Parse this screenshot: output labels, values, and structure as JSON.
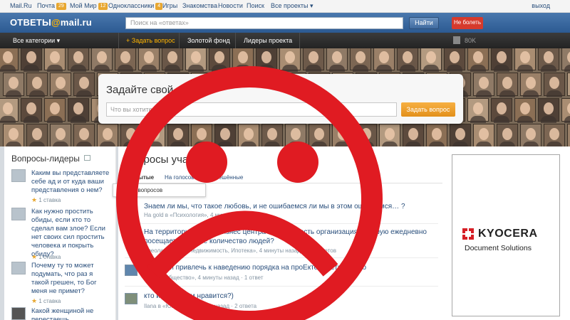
{
  "portal_bar": {
    "links": [
      {
        "label": "Mail.Ru"
      },
      {
        "label": "Почта",
        "count": "29"
      },
      {
        "label": "Мой Мир",
        "count": "12"
      },
      {
        "label": "Одноклассники",
        "count": "4"
      },
      {
        "label": "Игры"
      },
      {
        "label": "Знакомства"
      },
      {
        "label": "Новости"
      },
      {
        "label": "Поиск"
      },
      {
        "label": "Все проекты ▾"
      }
    ],
    "exit_label": "выход"
  },
  "header": {
    "logo_left": "ОТВЕТЫ",
    "logo_at": "@",
    "logo_right": "mail.ru",
    "search_placeholder": "Поиск на «ответах»",
    "find_button": "Найти",
    "no_ill_button": "Не болеть"
  },
  "nav": {
    "categories": "Все категории ▾",
    "ask": "+ Задать вопрос",
    "golden": "Золотой фонд",
    "leaders": "Лидеры проекта",
    "online_count": "80K"
  },
  "ask_panel": {
    "title": "Задайте свой вопрос",
    "input_placeholder": "Что вы хотите узнать",
    "submit": "Задать вопрос"
  },
  "left": {
    "title": "Вопросы-лидеры",
    "questions": [
      {
        "text": "Каким вы представляете себе ад и от куда ваши представления о нем?",
        "meta": "1 ставка"
      },
      {
        "text": "Как нужно простить обиды, если кто то сделал вам злое? Если нет своих сил простить человека и покрыть обиду?",
        "meta": "1 ставка"
      },
      {
        "text": "Почему ту то может подумать, что раз я такой грешен, то Бог меня не примет?",
        "meta": "1 ставка"
      },
      {
        "text": "Какой женщиной не перестаешь",
        "meta": ""
      }
    ]
  },
  "main": {
    "title": "Вопросы участн",
    "tabs": [
      "Открытые",
      "На голосовании",
      "Решённые"
    ],
    "dropdown_item": "Новых вопросов",
    "questions": [
      {
        "text": "Знаем ли мы, что такое любовь, и не ошибаемся ли мы в этом ошибаемся… ?",
        "meta": "На gold в «Психология», 4 минуты назад"
      },
      {
        "text": "На территории какого бизнес центра в Москве есть организация, которую ежедневно посещает большое количество людей?",
        "meta": "Ареола г. М... в «Недвижимость, Ипотека», 4 минуты назад · нет ответов"
      },
      {
        "text": "Путина и привлечь к наведению порядка на проЕкте ответы можно",
        "meta": "му... в «Общество», 4 минуты назад · 1 ответ"
      },
      {
        "text": "кто из «…» вам нравится?)",
        "meta": "Ilana в «Юмор», 4 минуты назад · 2 ответа"
      }
    ]
  },
  "ad": {
    "brand": "KYOCERA",
    "subtitle": "Document Solutions",
    "brand_color": "#d61f26"
  },
  "overlay": {
    "color": "#e01b22"
  }
}
